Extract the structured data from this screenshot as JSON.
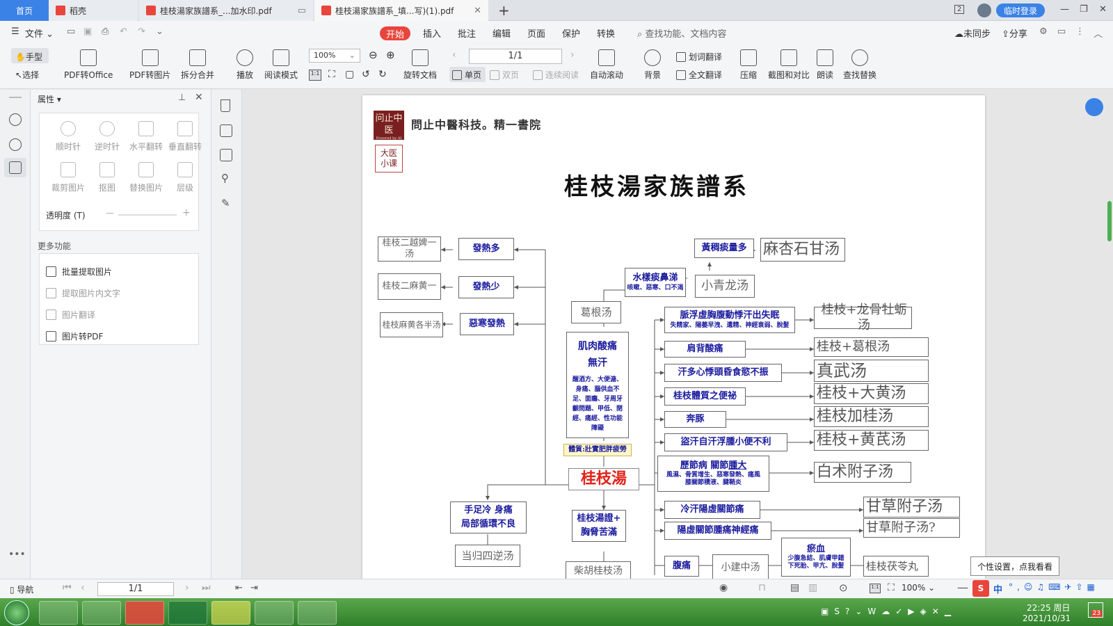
{
  "tabs": {
    "home": "首页",
    "t1": "稻壳",
    "t2": "桂枝湯家族譜系_...加水印.pdf",
    "t3": "桂枝湯家族譜系_填...写)(1).pdf",
    "count": "2",
    "login": "临时登录"
  },
  "menu": {
    "file": "文件",
    "items": [
      "开始",
      "插入",
      "批注",
      "编辑",
      "页面",
      "保护",
      "转换"
    ],
    "search": "查找功能、文档内容",
    "unsync": "未同步",
    "share": "分享"
  },
  "ribbon": {
    "hand": "手型",
    "select": "选择",
    "pdf2office": "PDF转Office",
    "pdf2img": "PDF转图片",
    "split": "拆分合并",
    "play": "播放",
    "read": "阅读模式",
    "zoom": "100%",
    "rotate": "旋转文档",
    "page": "1/1",
    "single": "单页",
    "double": "双页",
    "continuous": "连续阅读",
    "autoscroll": "自动滚动",
    "bg": "背景",
    "wordtrans": "划词翻译",
    "fulltrans": "全文翻译",
    "compress": "压缩",
    "crop": "截图和对比",
    "readaloud": "朗读",
    "findreplace": "查找替换"
  },
  "panel": {
    "title": "属性",
    "tools": [
      "顺时针",
      "逆时针",
      "水平翻转",
      "垂直翻转",
      "裁剪图片",
      "抠图",
      "替换图片",
      "层级"
    ],
    "opacity": "透明度 (T)",
    "more_title": "更多功能",
    "more": [
      "批量提取图片",
      "提取图片内文字",
      "图片翻译",
      "图片转PDF"
    ]
  },
  "doc": {
    "logo1": "问止中医",
    "logo_sub": "Powered by AI",
    "logo2": "大医小课",
    "brand": "問止中醫科技。精一書院",
    "title": "桂枝湯家族譜系",
    "nodes": {
      "l1": "桂枝二越婢一汤",
      "l2": "桂枝二麻黄一",
      "l3": "桂枝麻黄各半汤",
      "s1": "發熱多",
      "s2": "發熱少",
      "s3": "惡寒發熱",
      "ge": "葛根汤",
      "shui": "水樣痰鼻涕",
      "shui_sub": "咳嗽、惡寒、口不渴",
      "huang": "黃稠痰量多",
      "maxing": "麻杏石甘汤",
      "xql": "小青龙汤",
      "jirou1": "肌肉酸痛",
      "jirou2": "無汗",
      "jirou_sub": "醒酒方、大便溏、身痛、腦供血不足、面癱、牙周牙齦問題、甲低、閉經、痛經、性功能障礙",
      "tizhi": "體質:壯實肥胖疲勞",
      "main": "桂枝湯",
      "r1": "脈浮虛胸腹動悸汗出失眠",
      "r1_sub": "失精家、陽萎早洩、遺精、神經衰弱、脫髮",
      "r2": "肩背酸痛",
      "r3": "汗多心悸頭昏食慾不振",
      "r4": "桂枝體質之便祕",
      "r5": "奔豚",
      "r6": "盜汗自汗浮腫小便不利",
      "r7a": "歷節病 關節",
      "r7b": "腫大",
      "r7_sub1": "風濕、骨質增生、惡寒發熱、痛風",
      "r7_sub2": "膝關節積液、腱鞘炎",
      "r8": "冷汗陽虛關節痛",
      "r9": "陽虛關節腫痛神經痛",
      "r10": "腹痛",
      "f1": "桂枝+龙骨牡蛎汤",
      "f2": "桂枝+葛根汤",
      "f3": "真武汤",
      "f4": "桂枝+大黄汤",
      "f5": "桂枝加桂汤",
      "f6": "桂枝+黄芪汤",
      "f7": "白术附子汤",
      "f8": "甘草附子汤",
      "f9": "甘草附子汤?",
      "shou1": "手足冷 身痛",
      "shou2": "局部循環不良",
      "dg": "当归四逆汤",
      "xiong1": "桂枝湯證+",
      "xiong2": "胸脅苦滿",
      "chai": "柴胡桂枝汤",
      "xjz": "小建中汤",
      "yu": "瘀血",
      "yu_sub1": "少腹急結、肌膚甲錯",
      "yu_sub2": "下死胎、甲亢、脫髮",
      "fl": "桂枝茯苓丸"
    }
  },
  "status": {
    "nav": "导航",
    "page": "1/1",
    "zoom": "100%",
    "tooltip": "个性设置，点我看看"
  },
  "taskbar": {
    "time": "22:25 周日",
    "date": "2021/10/31",
    "badge": "23",
    "ime": "中"
  }
}
